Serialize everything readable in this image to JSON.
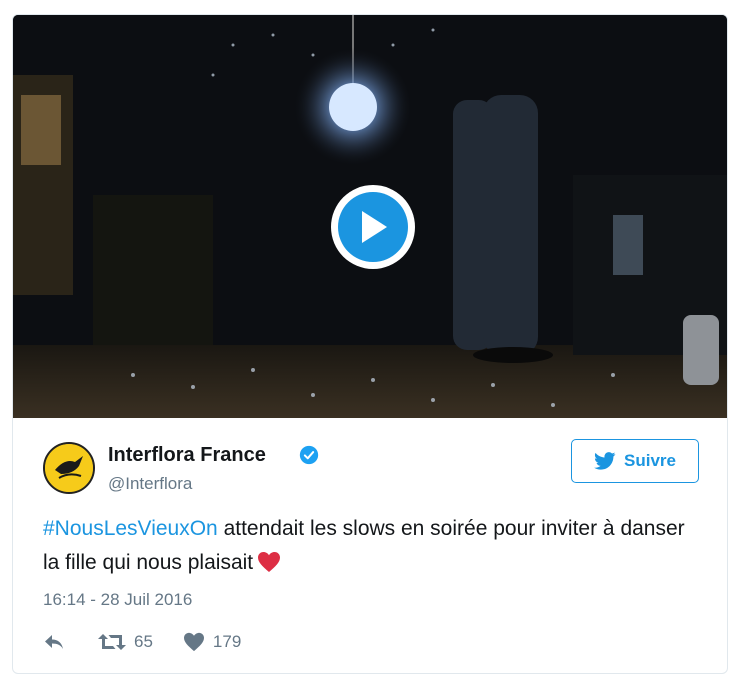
{
  "media": {
    "type": "video",
    "play_icon": "play-icon"
  },
  "tweet": {
    "author_name": "Interflora France",
    "author_handle": "@Interflora",
    "verified_icon": "verified-badge-icon",
    "follow_label": "Suivre",
    "follow_icon": "twitter-bird-icon",
    "hashtag": "#NousLesVieuxOn",
    "text_rest": " attendait les slows en soirée pour inviter à danser la fille qui nous plaisait",
    "emoji": "red-heart-icon",
    "timestamp": "16:14 - 28 Juil 2016",
    "actions": {
      "reply_icon": "reply-icon",
      "retweet_icon": "retweet-icon",
      "retweet_count": "65",
      "like_icon": "heart-icon",
      "like_count": "179"
    }
  },
  "colors": {
    "accent": "#1b95e0",
    "secondary_text": "#657786",
    "heart": "#e0245e",
    "avatar_bg": "#f6cb1a"
  }
}
